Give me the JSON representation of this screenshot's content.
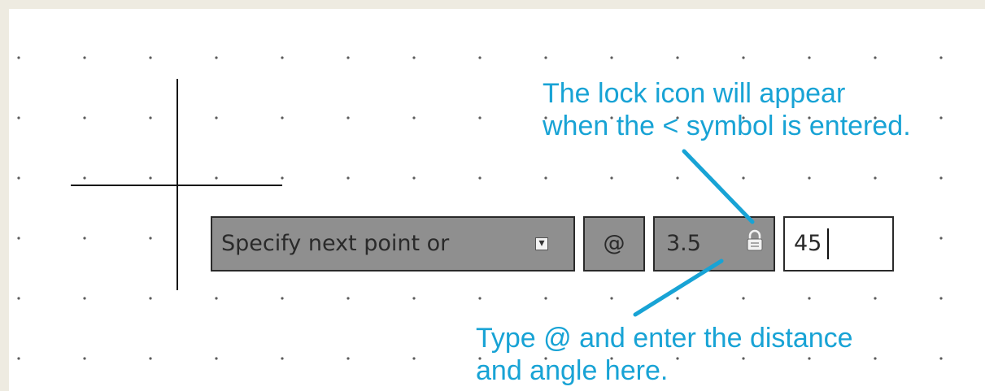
{
  "command_line": {
    "prompt": "Specify next point or",
    "expand_icon_name": "down-arrow-icon"
  },
  "input_fields": {
    "relative_symbol": "@",
    "distance": "3.5",
    "angle": "45"
  },
  "icons": {
    "lock": "lock-icon"
  },
  "annotations": {
    "lock_note": {
      "line1": "The lock icon will appear",
      "line2": "when the < symbol is entered."
    },
    "input_note": {
      "line1": "Type @ and enter the distance",
      "line2": "and angle here."
    }
  },
  "colors": {
    "annotation_text": "#18a3d5",
    "leader_line": "#18a3d5",
    "field_background": "#8f8f8f",
    "active_field_background": "#ffffff"
  }
}
